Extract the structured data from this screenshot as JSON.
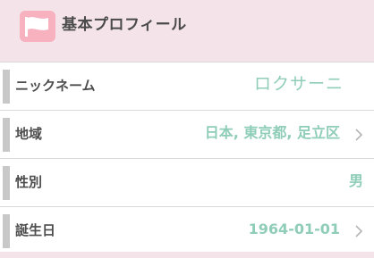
{
  "header": {
    "title": "基本プロフィール"
  },
  "rows": [
    {
      "label": "ニックネーム",
      "value": "ロクサーニ"
    },
    {
      "label": "地域",
      "value": "日本, 東京都, 足立区"
    },
    {
      "label": "性別",
      "value": "男"
    },
    {
      "label": "誕生日",
      "value": "1964-01-01"
    }
  ],
  "colors": {
    "background": "#f4e4ea",
    "icon": "#f7b1bf",
    "value_text": "#8fcdb8",
    "label_text": "#4d4d4d"
  }
}
